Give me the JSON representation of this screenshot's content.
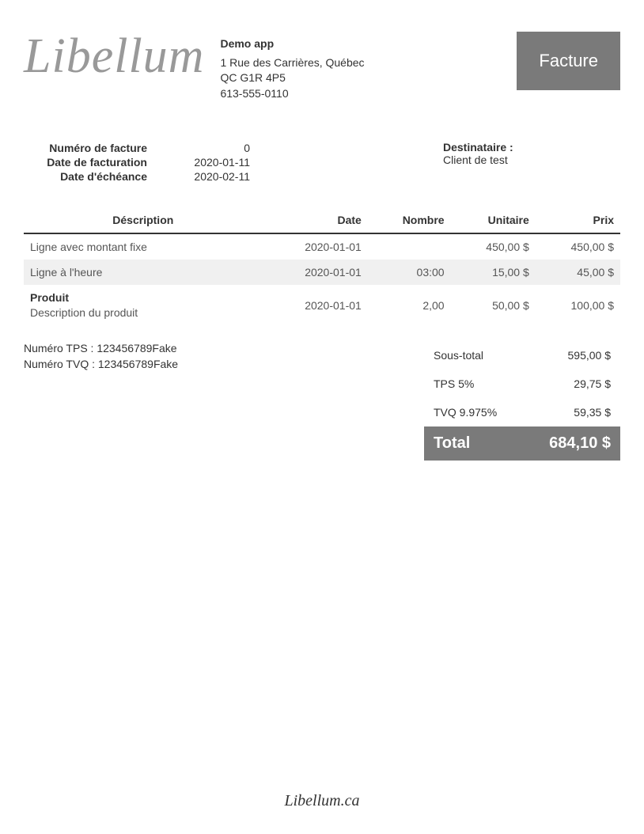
{
  "header": {
    "logo": "Libellum",
    "company_name": "Demo app",
    "address1": "1 Rue des Carrières, Québec",
    "address2": "QC G1R 4P5",
    "phone": "613-555-0110",
    "doc_type": "Facture"
  },
  "meta": {
    "labels": {
      "invoice_no": "Numéro de facture",
      "invoice_date": "Date de facturation",
      "due_date": "Date d'échéance"
    },
    "values": {
      "invoice_no": "0",
      "invoice_date": "2020-01-11",
      "due_date": "2020-02-11"
    }
  },
  "recipient": {
    "label": "Destinataire :",
    "name": "Client de test"
  },
  "table": {
    "headers": {
      "description": "Déscription",
      "date": "Date",
      "number": "Nombre",
      "unit": "Unitaire",
      "price": "Prix"
    },
    "rows": [
      {
        "title": "Ligne avec montant fixe",
        "desc": "",
        "date": "2020-01-01",
        "number": "",
        "unit": "450,00 $",
        "price": "450,00 $"
      },
      {
        "title": "Ligne à l'heure",
        "desc": "",
        "date": "2020-01-01",
        "number": "03:00",
        "unit": "15,00 $",
        "price": "45,00 $"
      },
      {
        "title": "Produit",
        "desc": "Description du produit",
        "date": "2020-01-01",
        "number": "2,00",
        "unit": "50,00 $",
        "price": "100,00 $"
      }
    ]
  },
  "tax_numbers": {
    "tps": "Numéro TPS : 123456789Fake",
    "tvq": "Numéro TVQ : 123456789Fake"
  },
  "totals": {
    "subtotal_label": "Sous-total",
    "subtotal": "595,00 $",
    "tps_label": "TPS 5%",
    "tps": "29,75 $",
    "tvq_label": "TVQ 9.975%",
    "tvq": "59,35 $",
    "total_label": "Total",
    "total": "684,10 $"
  },
  "footer": "Libellum.ca"
}
